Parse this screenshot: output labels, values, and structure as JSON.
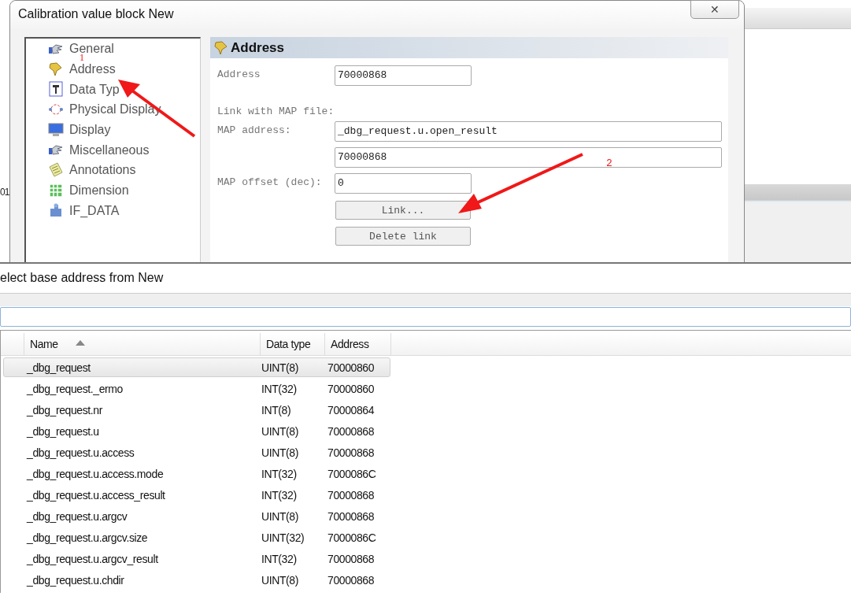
{
  "background": {
    "fragment": "01"
  },
  "dialog": {
    "title": "Calibration value block New",
    "close": "✕",
    "tree": [
      {
        "label": "General"
      },
      {
        "label": "Address"
      },
      {
        "label": "Data Typ"
      },
      {
        "label": "Physical Display"
      },
      {
        "label": "Display"
      },
      {
        "label": "Miscellaneous"
      },
      {
        "label": "Annotations"
      },
      {
        "label": "Dimension"
      },
      {
        "label": "IF_DATA"
      }
    ],
    "pane": {
      "title": "Address",
      "rows": [
        {
          "kind": "field",
          "label": "Address",
          "value": "70000868",
          "wide": false
        },
        {
          "kind": "note",
          "label": "Link with MAP file:"
        },
        {
          "kind": "field",
          "label": "MAP address:",
          "value": "_dbg_request.u.open_result",
          "wide": true
        },
        {
          "kind": "field",
          "value": "70000868",
          "wide": true
        },
        {
          "kind": "field",
          "label": "MAP offset (dec):",
          "value": "0",
          "wide": false
        },
        {
          "kind": "button",
          "label": "Link..."
        },
        {
          "kind": "button",
          "label": "Delete link"
        }
      ]
    }
  },
  "annotations": [
    {
      "label": "1"
    },
    {
      "label": "2"
    }
  ],
  "picker": {
    "title": "elect base address from New",
    "columns": [
      {
        "label": "Name",
        "sorted": true
      },
      {
        "label": "Data type",
        "sorted": false
      },
      {
        "label": "Address",
        "sorted": false
      }
    ],
    "rows": [
      {
        "name": "_dbg_request",
        "type": "UINT(8)",
        "address": "70000860",
        "selected": true
      },
      {
        "name": "_dbg_request._ermo",
        "type": "INT(32)",
        "address": "70000860",
        "selected": false
      },
      {
        "name": "_dbg_request.nr",
        "type": "INT(8)",
        "address": "70000864",
        "selected": false
      },
      {
        "name": "_dbg_request.u",
        "type": "UINT(8)",
        "address": "70000868",
        "selected": false
      },
      {
        "name": "_dbg_request.u.access",
        "type": "UINT(8)",
        "address": "70000868",
        "selected": false
      },
      {
        "name": "_dbg_request.u.access.mode",
        "type": "INT(32)",
        "address": "7000086C",
        "selected": false
      },
      {
        "name": "_dbg_request.u.access_result",
        "type": "INT(32)",
        "address": "70000868",
        "selected": false
      },
      {
        "name": "_dbg_request.u.argcv",
        "type": "UINT(8)",
        "address": "70000868",
        "selected": false
      },
      {
        "name": "_dbg_request.u.argcv.size",
        "type": "UINT(32)",
        "address": "7000086C",
        "selected": false
      },
      {
        "name": "_dbg_request.u.argcv_result",
        "type": "INT(32)",
        "address": "70000868",
        "selected": false
      },
      {
        "name": "_dbg_request.u.chdir",
        "type": "UINT(8)",
        "address": "70000868",
        "selected": false
      }
    ]
  }
}
